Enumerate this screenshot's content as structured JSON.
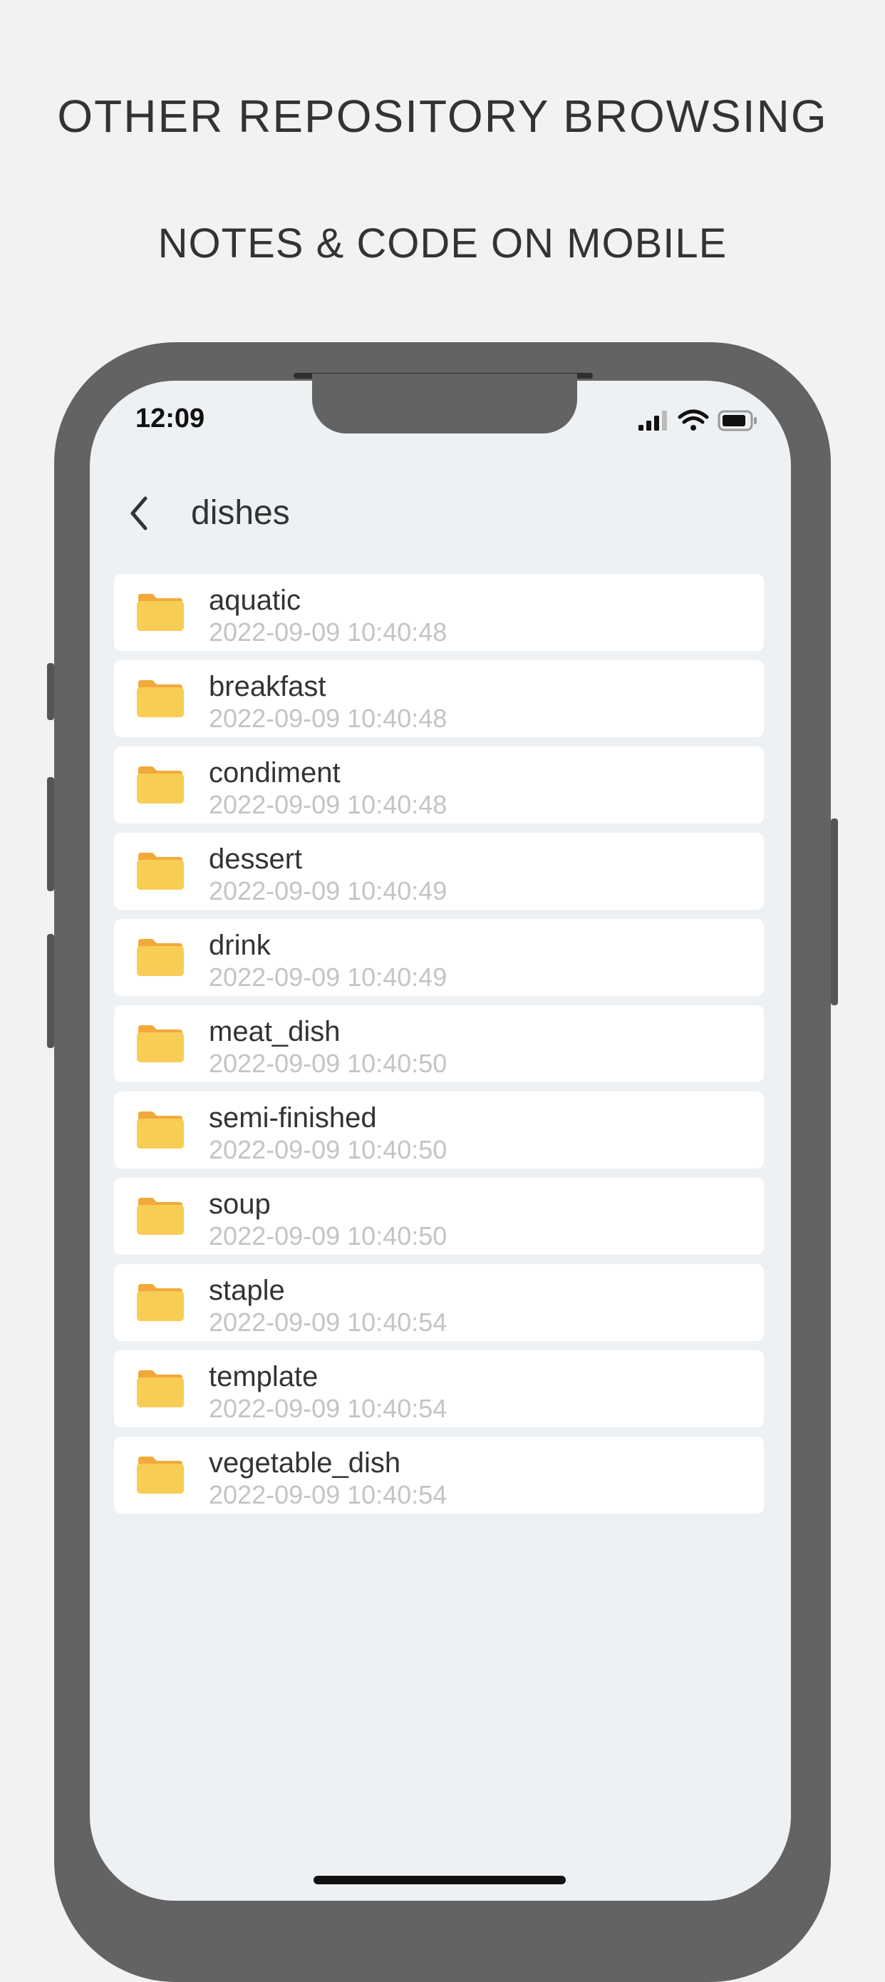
{
  "header": {
    "title": "OTHER REPOSITORY BROWSING",
    "subtitle": "NOTES & CODE ON MOBILE"
  },
  "status_bar": {
    "time": "12:09",
    "icons": [
      "signal-icon",
      "wifi-icon",
      "battery-icon"
    ]
  },
  "nav": {
    "back_icon": "chevron-left-icon",
    "title": "dishes"
  },
  "folders": [
    {
      "name": "aquatic",
      "date": "2022-09-09 10:40:48"
    },
    {
      "name": "breakfast",
      "date": "2022-09-09 10:40:48"
    },
    {
      "name": "condiment",
      "date": "2022-09-09 10:40:48"
    },
    {
      "name": "dessert",
      "date": "2022-09-09 10:40:49"
    },
    {
      "name": "drink",
      "date": "2022-09-09 10:40:49"
    },
    {
      "name": "meat_dish",
      "date": "2022-09-09 10:40:50"
    },
    {
      "name": "semi-finished",
      "date": "2022-09-09 10:40:50"
    },
    {
      "name": "soup",
      "date": "2022-09-09 10:40:50"
    },
    {
      "name": "staple",
      "date": "2022-09-09 10:40:54"
    },
    {
      "name": "template",
      "date": "2022-09-09 10:40:54"
    },
    {
      "name": "vegetable_dish",
      "date": "2022-09-09 10:40:54"
    }
  ],
  "colors": {
    "folder": "#f7cd55",
    "folder_tab": "#f2a93b",
    "screen_bg": "#eef1f4",
    "frame": "#636363"
  }
}
